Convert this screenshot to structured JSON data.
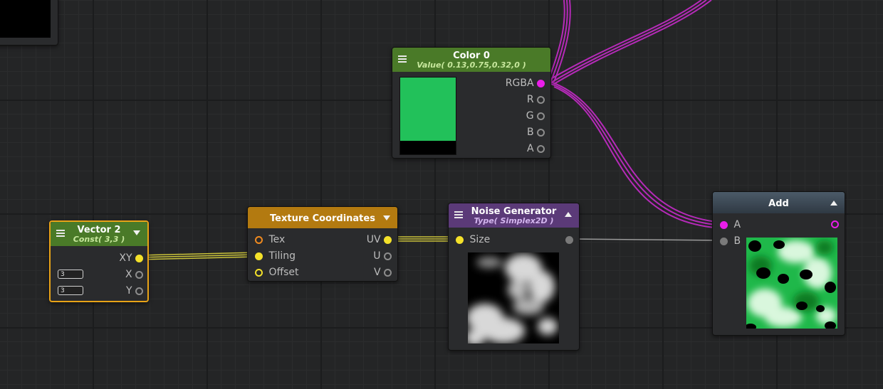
{
  "nodes": {
    "vector2": {
      "title": "Vector 2",
      "subtitle": "Const( 3,3 )",
      "outputs": [
        "XY",
        "X",
        "Y"
      ],
      "fields": [
        "3",
        "3"
      ]
    },
    "color0": {
      "title": "Color 0",
      "subtitle": "Value( 0.13,0.75,0.32,0 )",
      "outputs": [
        "RGBA",
        "R",
        "G",
        "B",
        "A"
      ],
      "swatch_color": "#22c15a"
    },
    "texcoords": {
      "title": "Texture Coordinates",
      "inputs": [
        "Tex",
        "Tiling",
        "Offset"
      ],
      "outputs": [
        "UV",
        "U",
        "V"
      ]
    },
    "noise": {
      "title": "Noise Generator",
      "subtitle": "Type( Simplex2D )",
      "inputs": [
        "Size"
      ]
    },
    "add": {
      "title": "Add",
      "inputs": [
        "A",
        "B"
      ]
    }
  },
  "colors": {
    "vector_header": "#4a7a28",
    "color_header": "#4a7a28",
    "texcoord_header": "#b37a10",
    "noise_header": "#5b3a78",
    "add_header": "#3e4b58",
    "wire_magenta": "#b52ab8",
    "wire_yellow": "#c9c23a",
    "selection": "#e8a317"
  },
  "icons": [
    "menu-icon",
    "collapse-arrow-icon",
    "expand-arrow-icon"
  ]
}
